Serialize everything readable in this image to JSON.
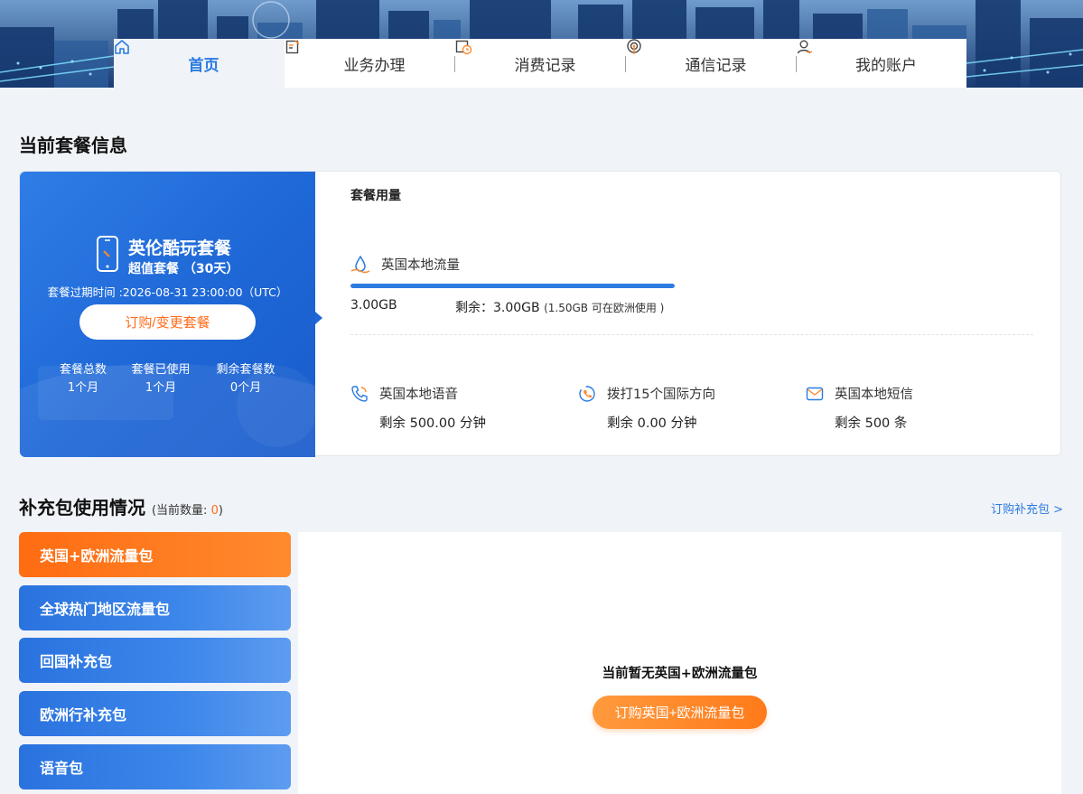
{
  "nav": {
    "items": [
      {
        "label": "首页",
        "icon": "home-icon"
      },
      {
        "label": "业务办理",
        "icon": "edit-document-icon"
      },
      {
        "label": "消费记录",
        "icon": "billing-clock-icon"
      },
      {
        "label": "通信记录",
        "icon": "signal-tower-icon"
      },
      {
        "label": "我的账户",
        "icon": "user-icon"
      }
    ]
  },
  "plan": {
    "section_title": "当前套餐信息",
    "name": "英伦酷玩套餐",
    "subtitle": "超值套餐 （30天）",
    "expire": "套餐过期时间 :2026-08-31 23:00:00（UTC）",
    "button": "订购/变更套餐",
    "stats": [
      {
        "label": "套餐总数",
        "value": "1个月"
      },
      {
        "label": "套餐已使用",
        "value": "1个月"
      },
      {
        "label": "剩余套餐数",
        "value": "0个月"
      }
    ]
  },
  "usage": {
    "title": "套餐用量",
    "data": {
      "label": "英国本地流量",
      "total": "3.00GB",
      "remain": "剩余：3.00GB",
      "remain_note": "(1.50GB 可在欧洲使用 )",
      "progress": 1.0
    },
    "services": [
      {
        "label": "英国本地语音",
        "value": "剩余 500.00 分钟",
        "icon": "phone-call-icon"
      },
      {
        "label": "拨打15个国际方向",
        "value": "剩余 0.00 分钟",
        "icon": "international-call-icon"
      },
      {
        "label": "英国本地短信",
        "value": "剩余 500 条",
        "icon": "mail-icon"
      }
    ]
  },
  "addon": {
    "section_title": "补充包使用情况",
    "count_prefix": "(当前数量: ",
    "count": "0",
    "count_suffix": ")",
    "order_link": "订购补充包 >",
    "items": [
      "英国+欧洲流量包",
      "全球热门地区流量包",
      "回国补充包",
      "欧洲行补充包",
      "语音包"
    ],
    "active_index": 0,
    "empty_text": "当前暂无英国+欧洲流量包",
    "empty_button": "订购英国+欧洲流量包"
  },
  "colors": {
    "accent_blue": "#2b7be0",
    "accent_orange": "#ff6b1a",
    "page_bg": "#f0f3f7"
  }
}
